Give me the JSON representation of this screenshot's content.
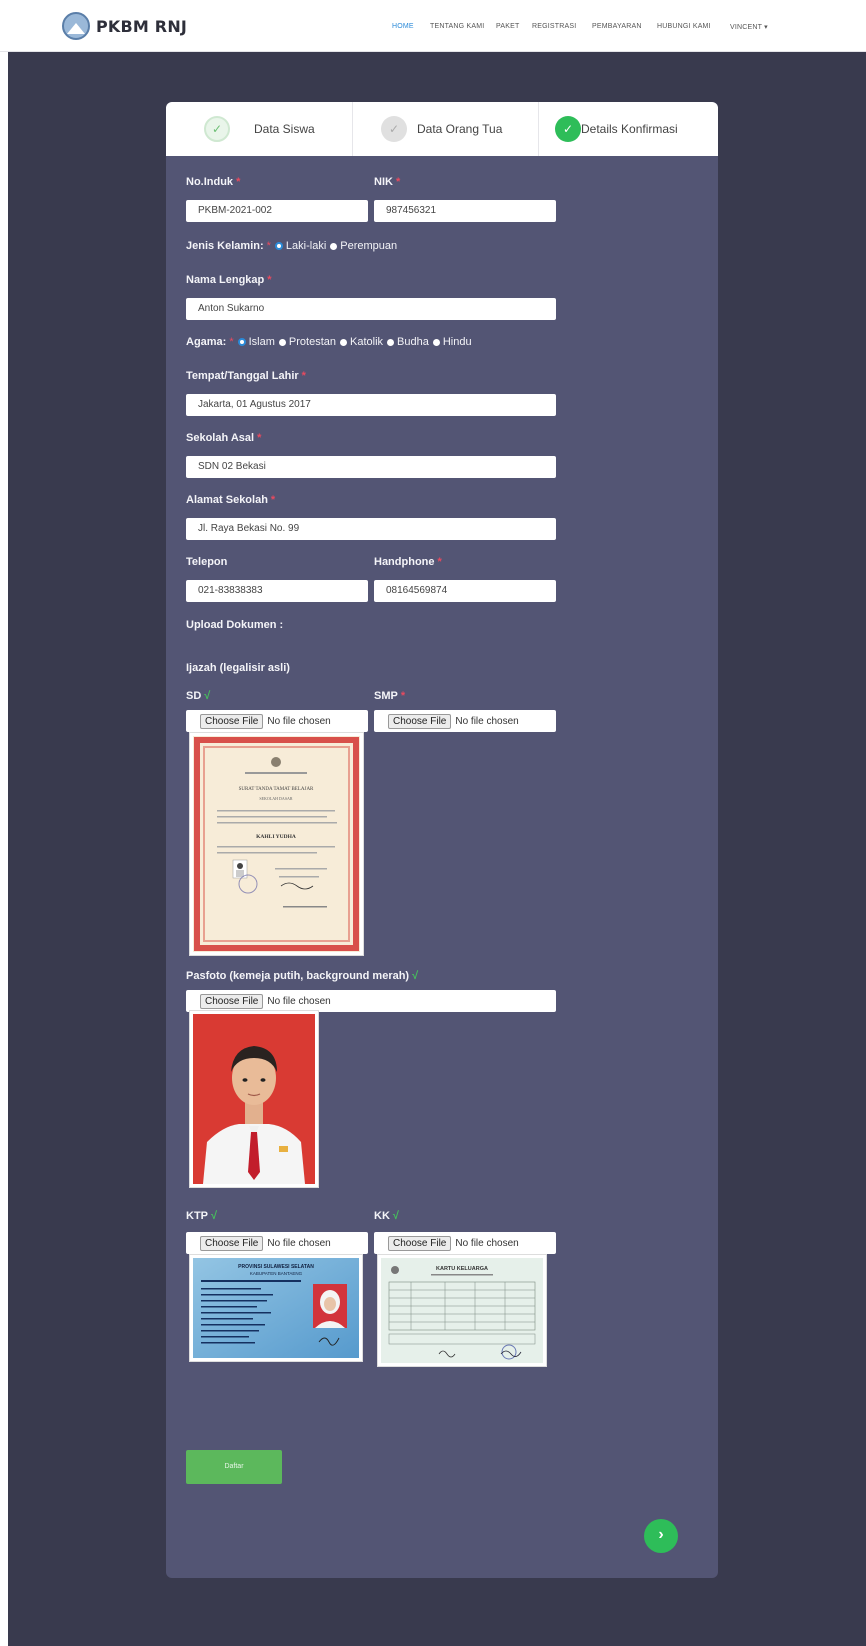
{
  "brand": {
    "name": "PKBM RNJ"
  },
  "nav": {
    "items": [
      {
        "label": "HOME",
        "active": true
      },
      {
        "label": "TENTANG KAMI"
      },
      {
        "label": "PAKET"
      },
      {
        "label": "REGISTRASI"
      },
      {
        "label": "PEMBAYARAN"
      },
      {
        "label": "HUBUNGI KAMI"
      },
      {
        "label": "VINCENT ▾"
      }
    ]
  },
  "steps": [
    {
      "label": "Data Siswa",
      "state": "done",
      "icon": "check-icon"
    },
    {
      "label": "Data Orang Tua",
      "state": "done",
      "icon": "check-icon"
    },
    {
      "label": "Details Konfirmasi",
      "state": "current",
      "icon": "check-icon"
    }
  ],
  "colors": {
    "accent_green": "#2ebd59",
    "card_bg": "#535574",
    "page_bg": "#393a4e",
    "required": "#e84a5f",
    "link_blue": "#2a8ad8"
  },
  "form": {
    "no_induk": {
      "label": "No.Induk",
      "value": "PKBM-2021-002"
    },
    "nik": {
      "label": "NIK",
      "value": "987456321"
    },
    "jenis_kelamin": {
      "label": "Jenis Kelamin:",
      "options": [
        "Laki-laki",
        "Perempuan"
      ],
      "selected": "Laki-laki"
    },
    "nama_lengkap": {
      "label": "Nama Lengkap",
      "value": "Anton Sukarno"
    },
    "agama": {
      "label": "Agama:",
      "options": [
        "Islam",
        "Protestan",
        "Katolik",
        "Budha",
        "Hindu"
      ],
      "selected": "Islam"
    },
    "ttl": {
      "label": "Tempat/Tanggal Lahir",
      "value": "Jakarta, 01 Agustus 2017"
    },
    "sekolah_asal": {
      "label": "Sekolah Asal",
      "value": "SDN 02 Bekasi"
    },
    "alamat_sekolah": {
      "label": "Alamat Sekolah",
      "value": "Jl. Raya Bekasi No. 99"
    },
    "telepon": {
      "label": "Telepon",
      "value": "021-83838383"
    },
    "handphone": {
      "label": "Handphone",
      "value": "08164569874"
    },
    "upload_heading": "Upload Dokumen :",
    "ijazah_heading": "Ijazah (legalisir asli)",
    "file_button": "Choose File",
    "no_file": "No file chosen",
    "sd": {
      "label": "SD"
    },
    "smp": {
      "label": "SMP"
    },
    "pasfoto": {
      "label": "Pasfoto (kemeja putih, background merah)"
    },
    "ktp": {
      "label": "KTP"
    },
    "kk": {
      "label": "KK"
    },
    "submit_label": "Daftar",
    "next_icon": "chevron-right-icon"
  },
  "images": {
    "sd_certificate": {
      "title": "SURAT TANDA TAMAT BELAJAR",
      "subtitle": "SEKOLAH DASAR",
      "name": "KAHLI YUDHA",
      "content": "elementary school certificate with red decorative border and small portrait photo"
    },
    "pasfoto": {
      "content": "portrait of a boy wearing a white shirt and red tie on a red background"
    },
    "ktp": {
      "header": "PROVINSI SULAWESI SELATAN",
      "sub": "KABUPATEN BANTAENG",
      "content": "Indonesian ID card with portrait photo"
    },
    "kk": {
      "header": "KARTU KELUARGA",
      "content": "family card document"
    }
  }
}
